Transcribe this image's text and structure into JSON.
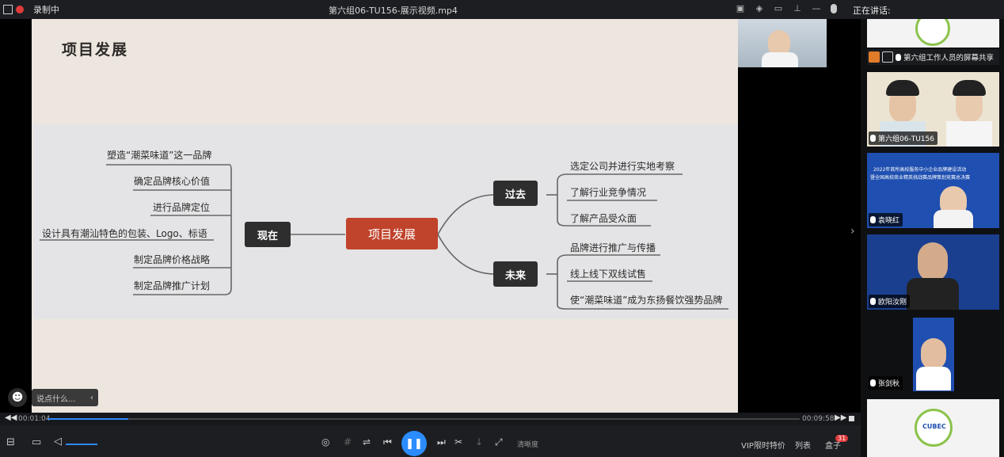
{
  "titlebar": {
    "recording_label": "录制中",
    "file_name": "第六组06-TU156-展示视频.mp4",
    "speaking_label": "正在讲话:"
  },
  "slide": {
    "title": "项目发展",
    "center": "项目发展",
    "left_node": "现在",
    "left_items": [
      "塑造“潮菜味道”这一品牌",
      "确定品牌核心价值",
      "进行品牌定位",
      "设计具有潮汕特色的包装、Logo、标语",
      "制定品牌价格战略",
      "制定品牌推广计划"
    ],
    "past_node": "过去",
    "past_items": [
      "选定公司并进行实地考察",
      "了解行业竞争情况",
      "了解产品受众面"
    ],
    "future_node": "未来",
    "future_items": [
      "品牌进行推广与传播",
      "线上线下双线试售",
      "使“潮菜味道”成为东扬餐饮强势品牌"
    ],
    "center_color": "#c0432b",
    "node_color": "#2e2e2e"
  },
  "chat": {
    "emoji_icon": "smile-icon",
    "placeholder": "说点什么..."
  },
  "player": {
    "current_time": "00:01:04",
    "total_time": "00:09:58",
    "progress": 0.107,
    "quality_label": "清晰度",
    "vip_label": "VIP限时特价",
    "list_label": "列表",
    "box_label": "盒子",
    "box_badge": "31",
    "accent": "#2b8cff"
  },
  "sidebar": {
    "share_text": "第六组工作人员的屏幕共享",
    "participants": [
      {
        "name": "第六组06-TU156"
      },
      {
        "name": "袁晓红"
      },
      {
        "name": "欧阳汝刚"
      },
      {
        "name": "张剑秋"
      }
    ],
    "banner_text_1": "2022年首所高校服务中小企业品牌建设活动",
    "banner_text_2": "暨全国高校商业精英挑战赛品牌策划竞赛总决赛",
    "logo_text": "CUBEC"
  }
}
